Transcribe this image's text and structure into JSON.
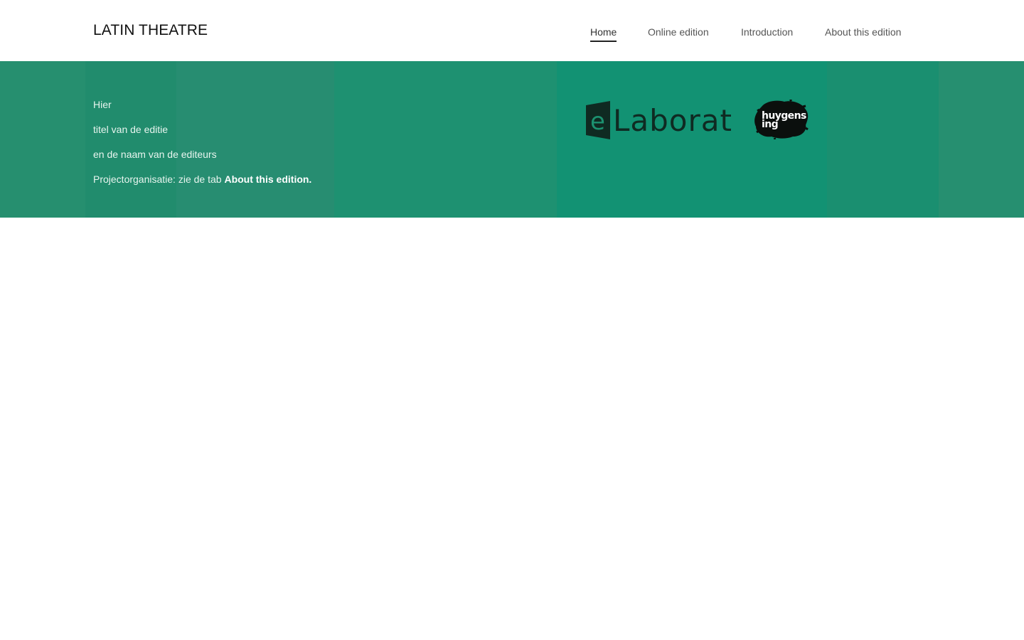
{
  "header": {
    "site_title": "LATIN THEATRE",
    "nav": [
      {
        "label": "Home",
        "active": true
      },
      {
        "label": "Online edition",
        "active": false
      },
      {
        "label": "Introduction",
        "active": false
      },
      {
        "label": "About this edition",
        "active": false
      }
    ]
  },
  "banner": {
    "line1": "Hier",
    "line2": "titel van de editie",
    "line3": "en de naam van de editeurs",
    "line4_prefix": "Projectorganisatie: zie de tab ",
    "line4_link": "About this edition.",
    "logos": {
      "elaborate_text": "Laborate",
      "elaborate_initial": "e",
      "huygens_line1": "huygens",
      "huygens_line2": "ing"
    }
  },
  "colors": {
    "banner": "#25906f",
    "nav_text": "#555555",
    "active_underline": "#222222",
    "banner_text": "#e8f5ef"
  }
}
